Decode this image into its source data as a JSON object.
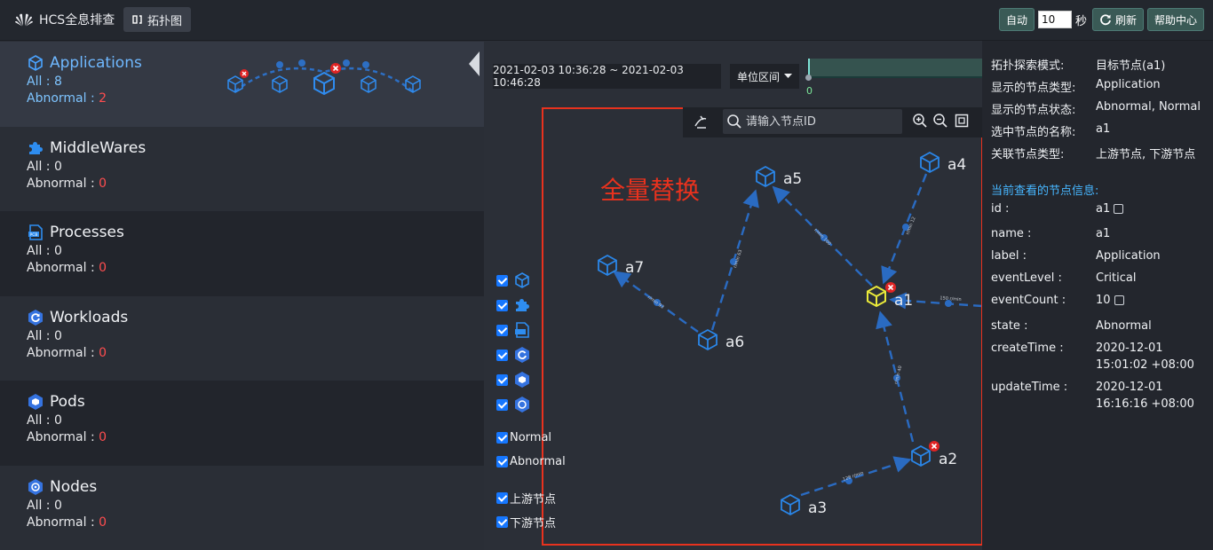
{
  "app": {
    "title": "HCS全息排查",
    "topology_button": "拓扑图"
  },
  "topbar": {
    "auto_label": "自动",
    "interval_value": "10",
    "seconds_label": "秒",
    "refresh_label": "刷新",
    "help_label": "帮助中心"
  },
  "categories": [
    {
      "name": "Applications",
      "all": "All : 8",
      "abnormal_label": "Abnormal : ",
      "abnormal_count": "2",
      "icon": "cube-icon"
    },
    {
      "name": "MiddleWares",
      "all": "All : 0",
      "abnormal_label": "Abnormal : ",
      "abnormal_count": "0",
      "icon": "puzzle-icon"
    },
    {
      "name": "Processes",
      "all": "All : 0",
      "abnormal_label": "Abnormal : ",
      "abnormal_count": "0",
      "icon": "process-icon"
    },
    {
      "name": "Workloads",
      "all": "All : 0",
      "abnormal_label": "Abnormal : ",
      "abnormal_count": "0",
      "icon": "workload-icon"
    },
    {
      "name": "Pods",
      "all": "All : 0",
      "abnormal_label": "Abnormal : ",
      "abnormal_count": "0",
      "icon": "pod-icon"
    },
    {
      "name": "Nodes",
      "all": "All : 0",
      "abnormal_label": "Abnormal : ",
      "abnormal_count": "0",
      "icon": "node-icon"
    }
  ],
  "time": {
    "range": "2021-02-03 10:36:28 ~ 2021-02-03 10:46:28",
    "unit_select": "单位区间",
    "timeline_zero": "0"
  },
  "graph": {
    "search_placeholder": "请输入节点ID",
    "overlay_label": "全量替换",
    "nodes": [
      {
        "id": "a1",
        "label": "a1",
        "abnormal": true,
        "selected": true
      },
      {
        "id": "a2",
        "label": "a2",
        "abnormal": true
      },
      {
        "id": "a3",
        "label": "a3"
      },
      {
        "id": "a4",
        "label": "a4"
      },
      {
        "id": "a5",
        "label": "a5"
      },
      {
        "id": "a6",
        "label": "a6"
      },
      {
        "id": "a7",
        "label": "a7"
      }
    ],
    "edges": [
      {
        "from": "a3",
        "to": "a2",
        "label": "128 r/min"
      },
      {
        "from": "a2",
        "to": "a1",
        "label": "r/min 40"
      },
      {
        "from": "a1",
        "to": "a5",
        "label": "r/min 100"
      },
      {
        "from": "a4",
        "to": "a1",
        "label": "r/min 12"
      },
      {
        "from": "a6",
        "to": "a5",
        "label": "r/min 63"
      },
      {
        "from": "a6",
        "to": "a7",
        "label": "r/min 93"
      },
      {
        "from": "out",
        "to": "a1",
        "label": "150 r/min"
      }
    ]
  },
  "filters": {
    "type_checks": [
      "cube-icon",
      "puzzle-icon",
      "process-icon",
      "workload-icon",
      "pod-icon",
      "node-icon"
    ],
    "normal": "Normal",
    "abnormal": "Abnormal",
    "upstream": "上游节点",
    "downstream": "下游节点"
  },
  "details": {
    "mode_key": "拓扑探索模式:",
    "mode_val": "目标节点(a1)",
    "types_key": "显示的节点类型:",
    "types_val": "Application",
    "states_key": "显示的节点状态:",
    "states_val": "Abnormal, Normal",
    "selected_key": "选中节点的名称:",
    "selected_val": "a1",
    "related_key": "关联节点类型:",
    "related_val": "上游节点, 下游节点",
    "info_title": "当前查看的节点信息:",
    "fields": [
      {
        "key": "id :",
        "value": "a1"
      },
      {
        "key": "name :",
        "value": "a1"
      },
      {
        "key": "label :",
        "value": "Application"
      },
      {
        "key": "eventLevel :",
        "value": "Critical"
      },
      {
        "key": "eventCount :",
        "value": "10"
      },
      {
        "key": "state :",
        "value": "Abnormal"
      },
      {
        "key": "createTime :",
        "value": "2020-12-01",
        "value2": "15:01:02 +08:00"
      },
      {
        "key": "updateTime :",
        "value": "2020-12-01",
        "value2": "16:16:16 +08:00"
      }
    ]
  },
  "colors": {
    "accent": "#1f8fff",
    "abnormal": "#ff4d4f",
    "selected": "#e9e93a",
    "highlight_box": "#e8321e"
  }
}
